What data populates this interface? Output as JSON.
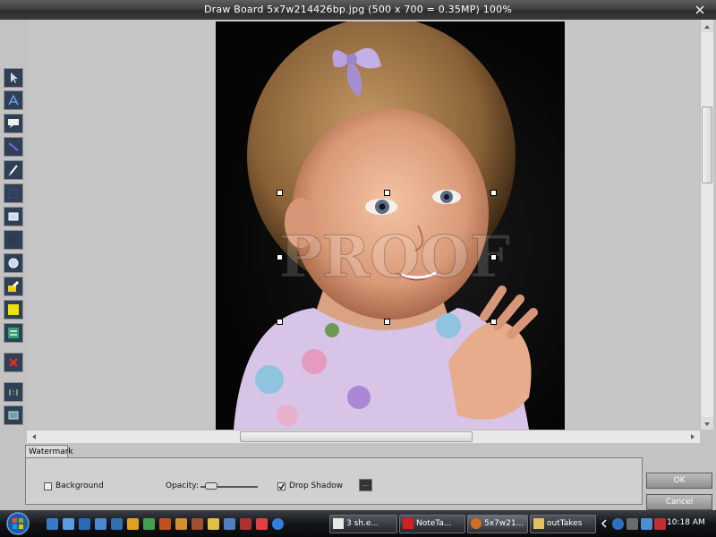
{
  "window": {
    "title": "Draw Board   5x7w214426bp.jpg  (500 x 700 = 0.35MP)     100%"
  },
  "watermark_panel": {
    "tab_label": "Watermark",
    "background_label": "Background",
    "background_checked": false,
    "opacity_label": "Opacity:",
    "opacity_value": 0.1,
    "drop_shadow_label": "Drop Shadow",
    "drop_shadow_checked": true,
    "more_button_label": "..."
  },
  "dialog_buttons": {
    "ok_label": "OK",
    "cancel_label": "Cancel"
  },
  "photo": {
    "watermark_text": "PROOF"
  },
  "taskbar": {
    "tasks": [
      {
        "label": "3 sh.e..."
      },
      {
        "label": "NoteTa..."
      },
      {
        "label": "5x7w21..."
      },
      {
        "label": "outTakes"
      }
    ],
    "clock": "10:18 AM"
  }
}
